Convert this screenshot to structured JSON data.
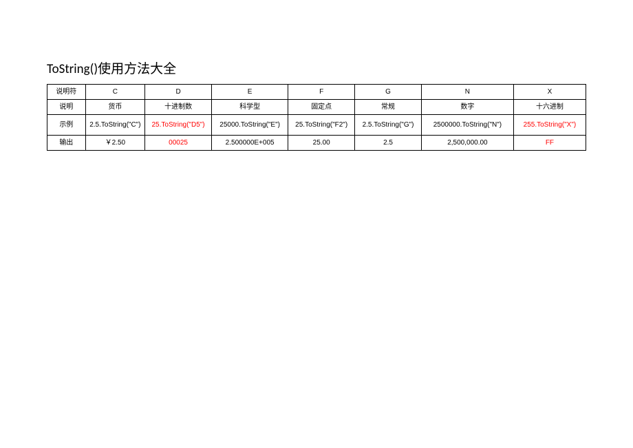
{
  "title": "ToString()使用方法大全",
  "labels": {
    "specifier": "说明符",
    "desc": "说明",
    "example": "示例",
    "output": "输出"
  },
  "cols": {
    "c": {
      "spec": "C",
      "desc": "货币",
      "example": "2.5.ToString(\"C\")",
      "output": "￥2.50"
    },
    "d": {
      "spec": "D",
      "desc": "十进制数",
      "example": "25.ToString(\"D5\")",
      "output": "00025"
    },
    "e": {
      "spec": "E",
      "desc": "科学型",
      "example": "25000.ToString(\"E\")",
      "output": "2.500000E+005"
    },
    "f": {
      "spec": "F",
      "desc": "固定点",
      "example": "25.ToString(\"F2\")",
      "output": "25.00"
    },
    "g": {
      "spec": "G",
      "desc": "常规",
      "example": "2.5.ToString(\"G\")",
      "output": "2.5"
    },
    "n": {
      "spec": "N",
      "desc": "数字",
      "example": "2500000.ToString(\"N\")",
      "output": "2,500,000.00"
    },
    "x": {
      "spec": "X",
      "desc": "十六进制",
      "example": "255.ToString(\"X\")",
      "output": "FF"
    }
  }
}
